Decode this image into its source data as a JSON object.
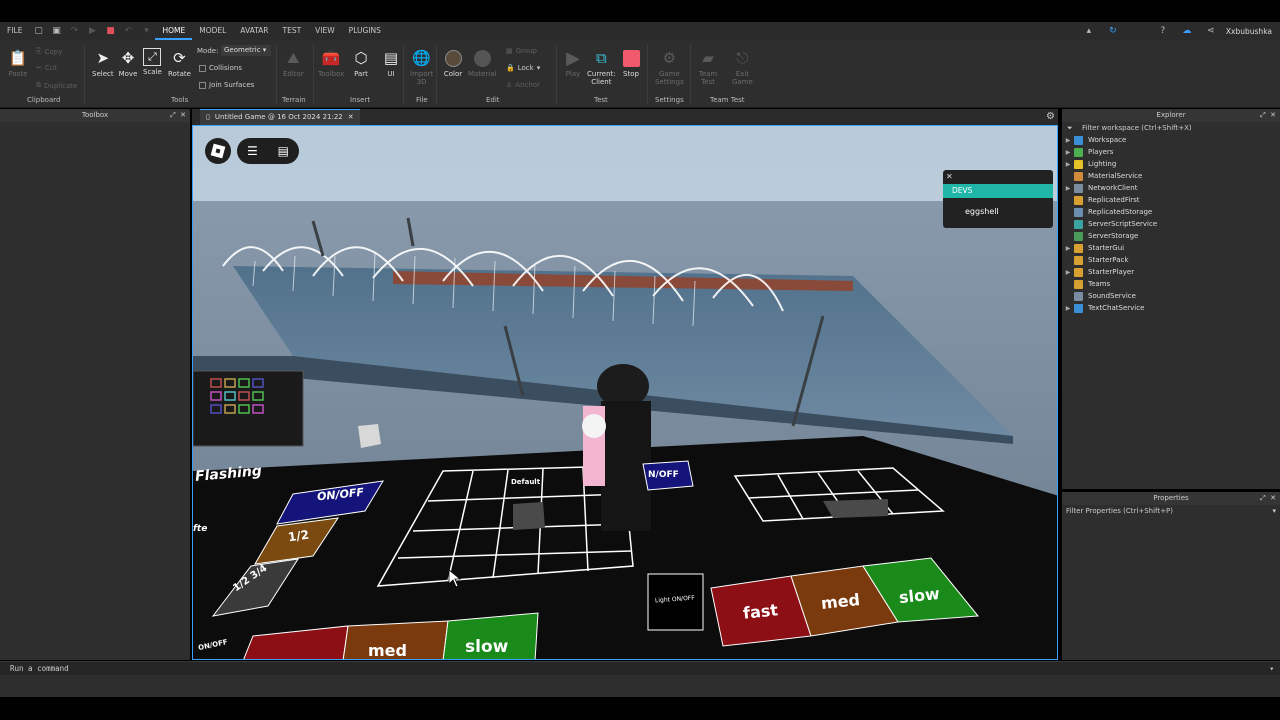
{
  "menubar": {
    "file": "FILE",
    "tabs": [
      "HOME",
      "MODEL",
      "AVATAR",
      "TEST",
      "VIEW",
      "PLUGINS"
    ],
    "active_tab": "HOME",
    "username": "Xxbubushka"
  },
  "ribbon": {
    "clipboard": {
      "paste": "Paste",
      "copy": "Copy",
      "cut": "Cut",
      "duplicate": "Duplicate",
      "label": "Clipboard"
    },
    "tools": {
      "select": "Select",
      "move": "Move",
      "scale": "Scale",
      "rotate": "Rotate",
      "mode_label": "Mode:",
      "mode_value": "Geometric",
      "collisions": "Collisions",
      "join_surfaces": "Join Surfaces",
      "label": "Tools"
    },
    "terrain": {
      "editor": "Editor",
      "label": "Terrain"
    },
    "insert": {
      "toolbox": "Toolbox",
      "part": "Part",
      "ui": "UI",
      "label": "Insert"
    },
    "file": {
      "import": "Import\n3D",
      "label": "File"
    },
    "edit": {
      "color": "Color",
      "material": "Material",
      "group": "Group",
      "lock": "Lock",
      "anchor": "Anchor",
      "label": "Edit"
    },
    "test": {
      "play": "Play",
      "current": "Current:\nClient",
      "stop": "Stop",
      "label": "Test"
    },
    "settings": {
      "game_settings": "Game\nSettings",
      "label": "Settings"
    },
    "team_test": {
      "team_test": "Team\nTest",
      "exit_game": "Exit\nGame",
      "label": "Team Test"
    }
  },
  "toolbox": {
    "title": "Toolbox"
  },
  "document_tab": {
    "title": "Untitled Game @ 16 Oct 2024 21:22"
  },
  "viewport": {
    "devs_header": "DEVS",
    "devs_member": "eggshell",
    "panel_labels": {
      "flashing": "Flashing",
      "on_off_left": "ON/OFF",
      "half": "1/2",
      "half_three_quarter": "1/2 3/4",
      "default": "Default",
      "on_off_center": "N/OFF",
      "light_on_off": "Light ON/OFF",
      "fast": "fast",
      "med": "med",
      "slow": "slow",
      "on_off_bottom": "ON/OFF",
      "fte": "fte"
    }
  },
  "explorer": {
    "title": "Explorer",
    "filter": "Filter workspace (Ctrl+Shift+X)",
    "items": [
      {
        "label": "Workspace",
        "expandable": true,
        "color": "#3b8fd6"
      },
      {
        "label": "Players",
        "expandable": true,
        "color": "#4caf50"
      },
      {
        "label": "Lighting",
        "expandable": true,
        "color": "#e6c229"
      },
      {
        "label": "MaterialService",
        "expandable": false,
        "color": "#d08a3a"
      },
      {
        "label": "NetworkClient",
        "expandable": true,
        "color": "#7a8ca0"
      },
      {
        "label": "ReplicatedFirst",
        "expandable": false,
        "color": "#d8a030"
      },
      {
        "label": "ReplicatedStorage",
        "expandable": false,
        "color": "#6a8fb0"
      },
      {
        "label": "ServerScriptService",
        "expandable": false,
        "color": "#3aa5a0"
      },
      {
        "label": "ServerStorage",
        "expandable": false,
        "color": "#4a9a5a"
      },
      {
        "label": "StarterGui",
        "expandable": true,
        "color": "#d8a030"
      },
      {
        "label": "StarterPack",
        "expandable": false,
        "color": "#d8a030"
      },
      {
        "label": "StarterPlayer",
        "expandable": true,
        "color": "#d8a030"
      },
      {
        "label": "Teams",
        "expandable": false,
        "color": "#d8a030"
      },
      {
        "label": "SoundService",
        "expandable": false,
        "color": "#7a8ca0"
      },
      {
        "label": "TextChatService",
        "expandable": true,
        "color": "#3b8fd6"
      }
    ]
  },
  "properties": {
    "title": "Properties",
    "filter": "Filter Properties (Ctrl+Shift+P)"
  },
  "command_bar": {
    "placeholder": "Run a command"
  },
  "colors": {
    "accent": "#3aa0ff",
    "devs": "#1fb6a8",
    "fast": "#8b0f14",
    "med": "#7a3a0e",
    "slow": "#1a8a1a",
    "onoff": "#14147a"
  }
}
